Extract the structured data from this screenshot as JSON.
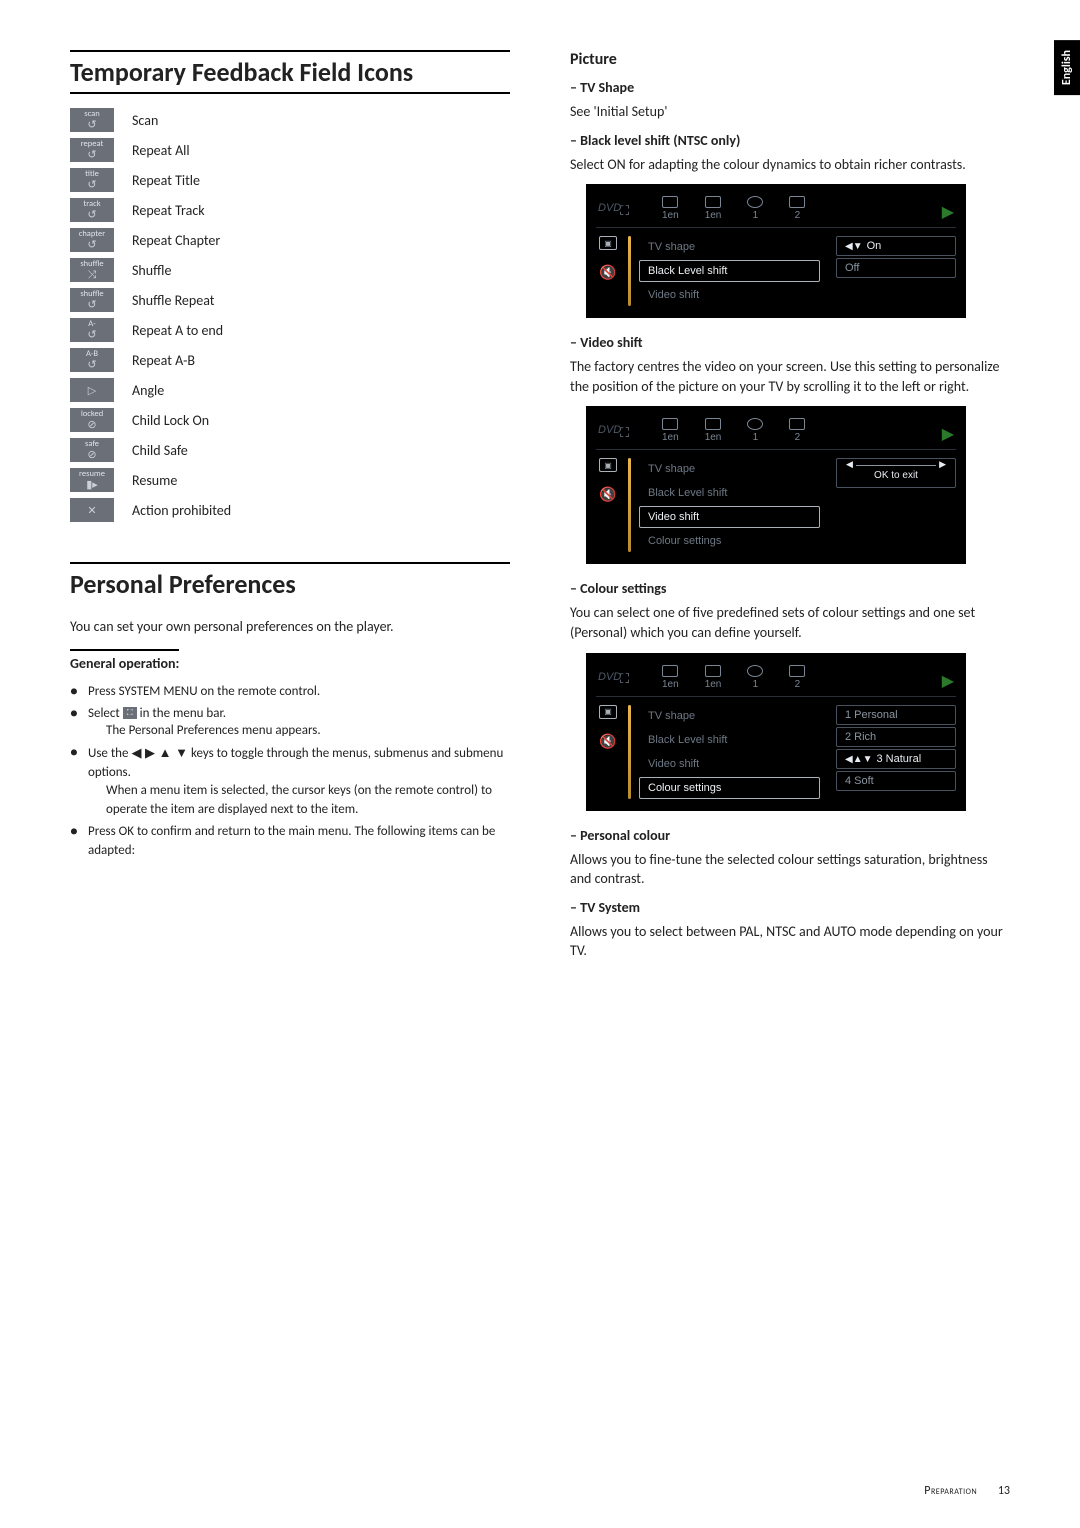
{
  "side_tab": "English",
  "left": {
    "title": "Temporary Feedback Field Icons",
    "icons": [
      {
        "top": "scan",
        "bot": "↺",
        "label": "Scan"
      },
      {
        "top": "repeat",
        "bot": "↺",
        "label": "Repeat All"
      },
      {
        "top": "title",
        "bot": "↺",
        "label": "Repeat Title"
      },
      {
        "top": "track",
        "bot": "↺",
        "label": "Repeat Track"
      },
      {
        "top": "chapter",
        "bot": "↺",
        "label": "Repeat Chapter"
      },
      {
        "top": "shuffle",
        "bot": "⤨",
        "label": "Shuffle"
      },
      {
        "top": "shuffle",
        "bot": "↺",
        "label": "Shuffle Repeat"
      },
      {
        "top": "A-",
        "bot": "↺",
        "label": "Repeat A to end"
      },
      {
        "top": "A-B",
        "bot": "↺",
        "label": "Repeat A-B"
      },
      {
        "top": "",
        "bot": "▷",
        "label": "Angle",
        "cls": "angle"
      },
      {
        "top": "locked",
        "bot": "⊘",
        "label": "Child Lock On"
      },
      {
        "top": "safe",
        "bot": "⊘",
        "label": "Child Safe"
      },
      {
        "top": "resume",
        "bot": "▮▸",
        "label": "Resume"
      },
      {
        "top": "",
        "bot": "✕",
        "label": "Action prohibited",
        "cls": "x"
      }
    ],
    "pp_title": "Personal Preferences",
    "pp_intro": "You can set your own personal preferences on the player.",
    "gen_op": "General operation:",
    "bullets": {
      "b1": "Press SYSTEM MENU on the remote control.",
      "b2a": "Select ",
      "b2b": " in the menu bar.",
      "b2_sub": "The Personal Preferences menu appears.",
      "b3a": "Use the ",
      "b3b": " keys to toggle through the menus, submenus and submenu options.",
      "b3_sub": "When a menu item is selected, the cursor keys (on the remote control) to operate the item are displayed next to the item.",
      "b4": "Press OK to confirm and return to the main menu. The following items can be adapted:"
    }
  },
  "right": {
    "picture": "Picture",
    "tv_shape_h": "–  TV Shape",
    "tv_shape_b": "See 'Initial Setup'",
    "black_h": "–  Black level shift (NTSC only)",
    "black_b": "Select ON for adapting the colour dynamics to obtain richer contrasts.",
    "video_h": "–  Video shift",
    "video_b": "The factory centres the video on your screen. Use this setting to personalize the position of the picture on your TV by scrolling it to the left or right.",
    "colour_h": "–  Colour settings",
    "colour_b": "You can select one of five predefined sets of colour settings and one set (Personal) which you can define yourself.",
    "pcolour_h": "–  Personal colour",
    "pcolour_b": "Allows you to fine-tune the selected colour settings saturation, brightness and contrast.",
    "tvsys_h": "–  TV System",
    "tvsys_b": "Allows you to select between PAL, NTSC and AUTO mode depending on your TV.",
    "tabs": {
      "t1": "1en",
      "t2": "1en",
      "t3": "1",
      "t4": "2"
    },
    "shot1": {
      "items": [
        "TV shape",
        "Black Level shift",
        "Video shift"
      ],
      "active_idx": 1,
      "vals": [
        "On",
        "Off"
      ],
      "active_val": 0
    },
    "shot2": {
      "items": [
        "TV shape",
        "Black Level shift",
        "Video shift",
        "Colour settings"
      ],
      "active_idx": 2,
      "slider_label": "OK to exit"
    },
    "shot3": {
      "items": [
        "TV shape",
        "Black Level shift",
        "Video shift",
        "Colour settings"
      ],
      "active_idx": 3,
      "vals": [
        "1 Personal",
        "2 Rich",
        "3 Natural",
        "4 Soft"
      ],
      "active_val": 2
    }
  },
  "footer": {
    "section": "Preparation",
    "page": "13"
  }
}
